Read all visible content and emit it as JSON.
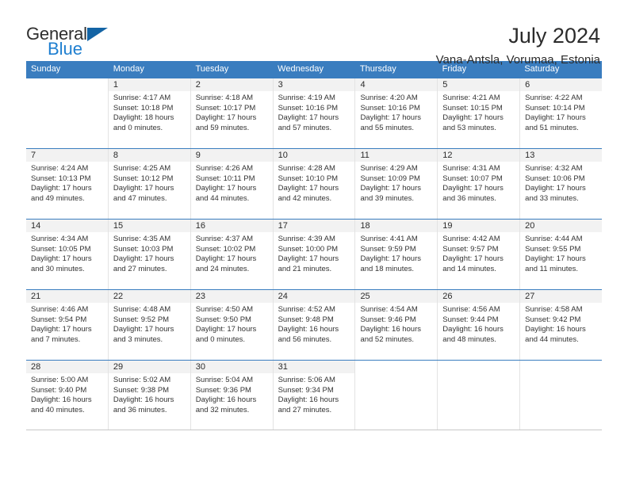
{
  "brand": {
    "name_part1": "General",
    "name_part2": "Blue",
    "mark_icon": "triangle-logo-icon",
    "mark_color": "#1464a5"
  },
  "header": {
    "month_title": "July 2024",
    "location": "Vana-Antsla, Vorumaa, Estonia"
  },
  "calendar": {
    "header_color": "#3a7dbf",
    "weekdays": [
      "Sunday",
      "Monday",
      "Tuesday",
      "Wednesday",
      "Thursday",
      "Friday",
      "Saturday"
    ],
    "weeks": [
      [
        {
          "day": "",
          "sunrise": "",
          "sunset": "",
          "daylight1": "",
          "daylight2": "",
          "blank": true
        },
        {
          "day": "1",
          "sunrise": "Sunrise: 4:17 AM",
          "sunset": "Sunset: 10:18 PM",
          "daylight1": "Daylight: 18 hours",
          "daylight2": "and 0 minutes."
        },
        {
          "day": "2",
          "sunrise": "Sunrise: 4:18 AM",
          "sunset": "Sunset: 10:17 PM",
          "daylight1": "Daylight: 17 hours",
          "daylight2": "and 59 minutes."
        },
        {
          "day": "3",
          "sunrise": "Sunrise: 4:19 AM",
          "sunset": "Sunset: 10:16 PM",
          "daylight1": "Daylight: 17 hours",
          "daylight2": "and 57 minutes."
        },
        {
          "day": "4",
          "sunrise": "Sunrise: 4:20 AM",
          "sunset": "Sunset: 10:16 PM",
          "daylight1": "Daylight: 17 hours",
          "daylight2": "and 55 minutes."
        },
        {
          "day": "5",
          "sunrise": "Sunrise: 4:21 AM",
          "sunset": "Sunset: 10:15 PM",
          "daylight1": "Daylight: 17 hours",
          "daylight2": "and 53 minutes."
        },
        {
          "day": "6",
          "sunrise": "Sunrise: 4:22 AM",
          "sunset": "Sunset: 10:14 PM",
          "daylight1": "Daylight: 17 hours",
          "daylight2": "and 51 minutes."
        }
      ],
      [
        {
          "day": "7",
          "sunrise": "Sunrise: 4:24 AM",
          "sunset": "Sunset: 10:13 PM",
          "daylight1": "Daylight: 17 hours",
          "daylight2": "and 49 minutes."
        },
        {
          "day": "8",
          "sunrise": "Sunrise: 4:25 AM",
          "sunset": "Sunset: 10:12 PM",
          "daylight1": "Daylight: 17 hours",
          "daylight2": "and 47 minutes."
        },
        {
          "day": "9",
          "sunrise": "Sunrise: 4:26 AM",
          "sunset": "Sunset: 10:11 PM",
          "daylight1": "Daylight: 17 hours",
          "daylight2": "and 44 minutes."
        },
        {
          "day": "10",
          "sunrise": "Sunrise: 4:28 AM",
          "sunset": "Sunset: 10:10 PM",
          "daylight1": "Daylight: 17 hours",
          "daylight2": "and 42 minutes."
        },
        {
          "day": "11",
          "sunrise": "Sunrise: 4:29 AM",
          "sunset": "Sunset: 10:09 PM",
          "daylight1": "Daylight: 17 hours",
          "daylight2": "and 39 minutes."
        },
        {
          "day": "12",
          "sunrise": "Sunrise: 4:31 AM",
          "sunset": "Sunset: 10:07 PM",
          "daylight1": "Daylight: 17 hours",
          "daylight2": "and 36 minutes."
        },
        {
          "day": "13",
          "sunrise": "Sunrise: 4:32 AM",
          "sunset": "Sunset: 10:06 PM",
          "daylight1": "Daylight: 17 hours",
          "daylight2": "and 33 minutes."
        }
      ],
      [
        {
          "day": "14",
          "sunrise": "Sunrise: 4:34 AM",
          "sunset": "Sunset: 10:05 PM",
          "daylight1": "Daylight: 17 hours",
          "daylight2": "and 30 minutes."
        },
        {
          "day": "15",
          "sunrise": "Sunrise: 4:35 AM",
          "sunset": "Sunset: 10:03 PM",
          "daylight1": "Daylight: 17 hours",
          "daylight2": "and 27 minutes."
        },
        {
          "day": "16",
          "sunrise": "Sunrise: 4:37 AM",
          "sunset": "Sunset: 10:02 PM",
          "daylight1": "Daylight: 17 hours",
          "daylight2": "and 24 minutes."
        },
        {
          "day": "17",
          "sunrise": "Sunrise: 4:39 AM",
          "sunset": "Sunset: 10:00 PM",
          "daylight1": "Daylight: 17 hours",
          "daylight2": "and 21 minutes."
        },
        {
          "day": "18",
          "sunrise": "Sunrise: 4:41 AM",
          "sunset": "Sunset: 9:59 PM",
          "daylight1": "Daylight: 17 hours",
          "daylight2": "and 18 minutes."
        },
        {
          "day": "19",
          "sunrise": "Sunrise: 4:42 AM",
          "sunset": "Sunset: 9:57 PM",
          "daylight1": "Daylight: 17 hours",
          "daylight2": "and 14 minutes."
        },
        {
          "day": "20",
          "sunrise": "Sunrise: 4:44 AM",
          "sunset": "Sunset: 9:55 PM",
          "daylight1": "Daylight: 17 hours",
          "daylight2": "and 11 minutes."
        }
      ],
      [
        {
          "day": "21",
          "sunrise": "Sunrise: 4:46 AM",
          "sunset": "Sunset: 9:54 PM",
          "daylight1": "Daylight: 17 hours",
          "daylight2": "and 7 minutes."
        },
        {
          "day": "22",
          "sunrise": "Sunrise: 4:48 AM",
          "sunset": "Sunset: 9:52 PM",
          "daylight1": "Daylight: 17 hours",
          "daylight2": "and 3 minutes."
        },
        {
          "day": "23",
          "sunrise": "Sunrise: 4:50 AM",
          "sunset": "Sunset: 9:50 PM",
          "daylight1": "Daylight: 17 hours",
          "daylight2": "and 0 minutes."
        },
        {
          "day": "24",
          "sunrise": "Sunrise: 4:52 AM",
          "sunset": "Sunset: 9:48 PM",
          "daylight1": "Daylight: 16 hours",
          "daylight2": "and 56 minutes."
        },
        {
          "day": "25",
          "sunrise": "Sunrise: 4:54 AM",
          "sunset": "Sunset: 9:46 PM",
          "daylight1": "Daylight: 16 hours",
          "daylight2": "and 52 minutes."
        },
        {
          "day": "26",
          "sunrise": "Sunrise: 4:56 AM",
          "sunset": "Sunset: 9:44 PM",
          "daylight1": "Daylight: 16 hours",
          "daylight2": "and 48 minutes."
        },
        {
          "day": "27",
          "sunrise": "Sunrise: 4:58 AM",
          "sunset": "Sunset: 9:42 PM",
          "daylight1": "Daylight: 16 hours",
          "daylight2": "and 44 minutes."
        }
      ],
      [
        {
          "day": "28",
          "sunrise": "Sunrise: 5:00 AM",
          "sunset": "Sunset: 9:40 PM",
          "daylight1": "Daylight: 16 hours",
          "daylight2": "and 40 minutes."
        },
        {
          "day": "29",
          "sunrise": "Sunrise: 5:02 AM",
          "sunset": "Sunset: 9:38 PM",
          "daylight1": "Daylight: 16 hours",
          "daylight2": "and 36 minutes."
        },
        {
          "day": "30",
          "sunrise": "Sunrise: 5:04 AM",
          "sunset": "Sunset: 9:36 PM",
          "daylight1": "Daylight: 16 hours",
          "daylight2": "and 32 minutes."
        },
        {
          "day": "31",
          "sunrise": "Sunrise: 5:06 AM",
          "sunset": "Sunset: 9:34 PM",
          "daylight1": "Daylight: 16 hours",
          "daylight2": "and 27 minutes."
        },
        {
          "day": "",
          "sunrise": "",
          "sunset": "",
          "daylight1": "",
          "daylight2": "",
          "blank": true
        },
        {
          "day": "",
          "sunrise": "",
          "sunset": "",
          "daylight1": "",
          "daylight2": "",
          "blank": true
        },
        {
          "day": "",
          "sunrise": "",
          "sunset": "",
          "daylight1": "",
          "daylight2": "",
          "blank": true
        }
      ]
    ]
  }
}
